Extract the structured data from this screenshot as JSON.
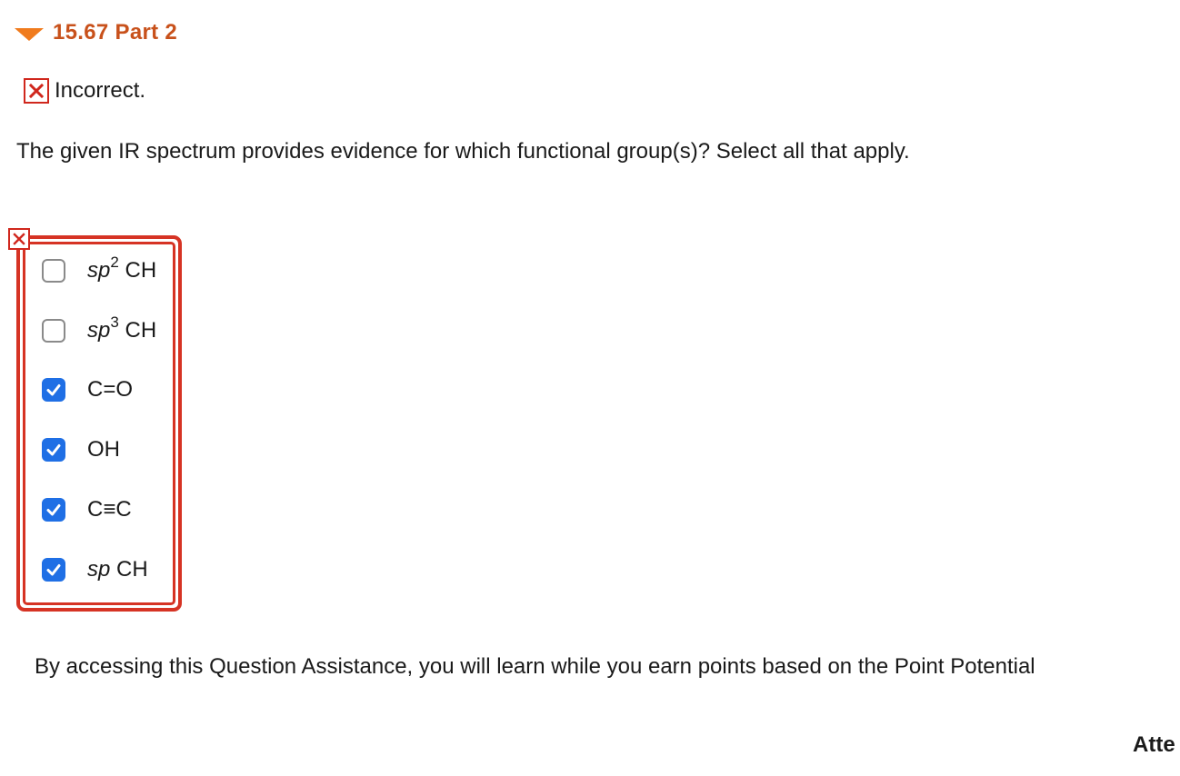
{
  "part": {
    "title": "15.67 Part 2",
    "expand_icon": "caret-down-icon",
    "accent_color": "#f07b1d",
    "title_color": "#c8511b"
  },
  "status": {
    "icon": "x-mark-icon",
    "text": "Incorrect.",
    "color": "#d0271d"
  },
  "question": {
    "text": "The given IR spectrum provides evidence for which functional group(s)? Select all that apply."
  },
  "answers": {
    "error_icon": "x-mark-icon",
    "options": [
      {
        "prefix": "sp",
        "sup": "2",
        "suffix": " CH",
        "italic_prefix": true,
        "checked": false
      },
      {
        "prefix": "sp",
        "sup": "3",
        "suffix": " CH",
        "italic_prefix": true,
        "checked": false
      },
      {
        "prefix": "",
        "sup": "",
        "suffix": "C=O",
        "italic_prefix": false,
        "checked": true
      },
      {
        "prefix": "",
        "sup": "",
        "suffix": "OH",
        "italic_prefix": false,
        "checked": true
      },
      {
        "prefix": "",
        "sup": "",
        "suffix": "C≡C",
        "italic_prefix": false,
        "checked": true
      },
      {
        "prefix": "sp",
        "sup": "",
        "suffix": " CH",
        "italic_prefix": true,
        "checked": true
      }
    ]
  },
  "assistance": {
    "text": "By accessing this Question Assistance, you will learn while you earn points based on the Point Potential"
  },
  "attempts": {
    "label": "Atte"
  }
}
